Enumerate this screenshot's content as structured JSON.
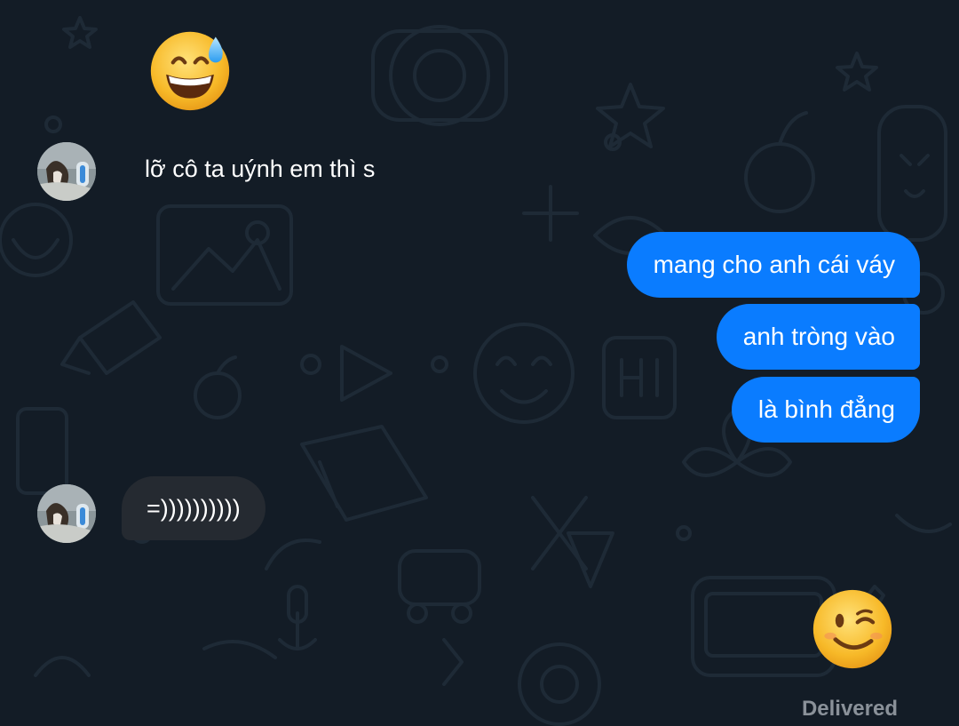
{
  "conversation": {
    "messages": [
      {
        "direction": "incoming",
        "kind": "emoji",
        "emoji": "grinning-face-with-sweat"
      },
      {
        "direction": "incoming",
        "kind": "text",
        "text": "lỡ cô ta uýnh em thì s"
      },
      {
        "direction": "outgoing",
        "kind": "text",
        "text": "mang cho anh cái váy"
      },
      {
        "direction": "outgoing",
        "kind": "text",
        "text": "anh tròng vào"
      },
      {
        "direction": "outgoing",
        "kind": "text",
        "text": "là bình đẳng"
      },
      {
        "direction": "incoming",
        "kind": "text",
        "text": "=))))))))))"
      },
      {
        "direction": "outgoing",
        "kind": "emoji",
        "emoji": "winking-face"
      }
    ],
    "status": "Delivered"
  },
  "colors": {
    "background": "#131c26",
    "outgoing_bubble": "#0a7cff",
    "incoming_bubble": "#252a31",
    "status_text": "#8a9199"
  }
}
